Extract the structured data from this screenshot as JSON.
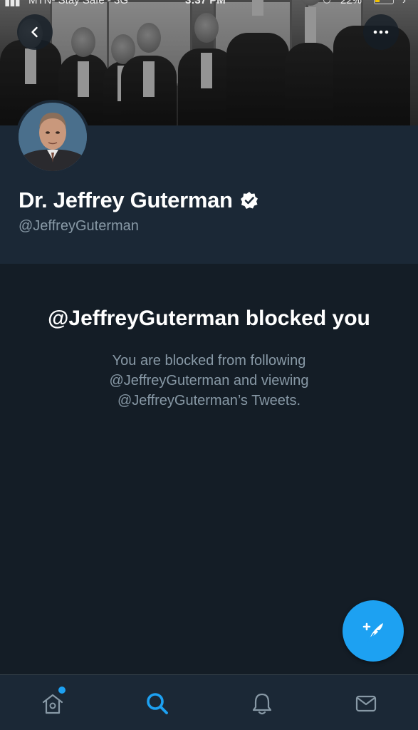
{
  "status_bar": {
    "signal": "▮▮▮",
    "carrier": "MTN- Stay Safe - 3G",
    "time": "3:37 PM",
    "battery": "22%",
    "battery_color": "#f2c200"
  },
  "profile": {
    "display_name": "Dr. Jeffrey Guterman",
    "handle": "@JeffreyGuterman",
    "verified": true
  },
  "blocked": {
    "title": "@JeffreyGuterman blocked you",
    "description": "You are blocked from following @JeffreyGuterman and viewing @JeffreyGuterman’s Tweets."
  },
  "nav": {
    "back_icon": "chevron-left-icon",
    "more_icon": "ellipsis-icon"
  },
  "fab": {
    "icon": "compose-feather-icon",
    "color": "#1da1f2"
  },
  "tab_bar": {
    "tabs": [
      {
        "name": "home",
        "icon": "home-icon",
        "has_notification_dot": true
      },
      {
        "name": "search",
        "icon": "search-icon",
        "active": true
      },
      {
        "name": "notifications",
        "icon": "bell-icon"
      },
      {
        "name": "messages",
        "icon": "mail-icon"
      }
    ]
  },
  "colors": {
    "background": "#141d26",
    "header_bg": "#1b2836",
    "secondary_text": "#8899a6",
    "accent": "#1da1f2"
  }
}
